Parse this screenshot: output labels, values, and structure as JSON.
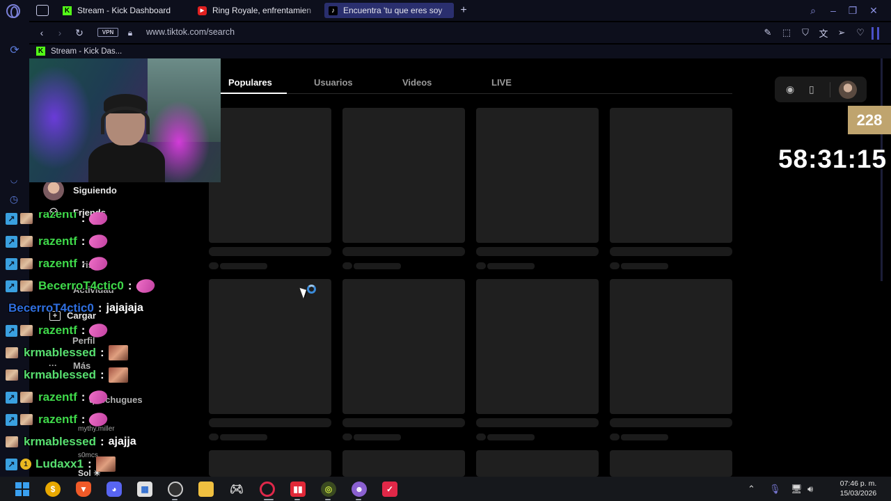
{
  "browser": {
    "tabs": [
      {
        "label": "Stream - Kick Dashboard",
        "favicon": "kick-icon",
        "active": false
      },
      {
        "label": "Ring Royale, enfrentamien",
        "favicon": "youtube-icon",
        "active": false
      },
      {
        "label": "Encuentra 'tu que eres soy",
        "favicon": "tiktok-icon",
        "active": true
      }
    ],
    "new_tab_symbol": "+",
    "vpn_label": "VPN",
    "url": "www.tiktok.com/search",
    "bookmark": {
      "label": "Stream - Kick Das...",
      "favicon": "kick-icon"
    }
  },
  "tiktok": {
    "tabs": [
      "Populares",
      "Usuarios",
      "Videos",
      "LIVE"
    ],
    "active_tab": "Populares",
    "sidebar": {
      "following": "Siguiendo",
      "friends": "Friends",
      "activity": "Actividad",
      "upload": "Cargar",
      "profile": "Perfil",
      "more": "Más",
      "faint_rows": [
        "risas",
        "quechugues"
      ],
      "accounts": [
        "mythy.miller",
        "s0mcs",
        "Sol ☀"
      ]
    }
  },
  "overlay": {
    "viewer_count": "228",
    "timer": "58:31:15"
  },
  "chat": [
    {
      "user": "razentf",
      "color": "#3fd94a",
      "badges": [
        "prime",
        "avatar"
      ],
      "emote": "pink"
    },
    {
      "user": "razentf",
      "color": "#3fd94a",
      "badges": [
        "prime",
        "avatar"
      ],
      "emote": "pink"
    },
    {
      "user": "razentf",
      "color": "#3fd94a",
      "badges": [
        "prime",
        "avatar"
      ],
      "emote": "pink"
    },
    {
      "user": "BecerroT4ctic0",
      "color": "#2f6fe0",
      "badges": [],
      "message": "jajajaja"
    },
    {
      "user": "razentf",
      "color": "#3fd94a",
      "badges": [
        "prime",
        "avatar"
      ],
      "emote": "pink"
    },
    {
      "user": "krmablessed",
      "color": "#58e070",
      "badges": [
        "avatar"
      ],
      "emote": "face"
    },
    {
      "user": "krmablessed",
      "color": "#58e070",
      "badges": [
        "avatar"
      ],
      "emote": "face"
    },
    {
      "user": "razentf",
      "color": "#3fd94a",
      "badges": [
        "prime",
        "avatar"
      ],
      "emote": "pink"
    },
    {
      "user": "razentf",
      "color": "#3fd94a",
      "badges": [
        "prime",
        "avatar"
      ],
      "emote": "pink"
    },
    {
      "user": "krmablessed",
      "color": "#58e070",
      "badges": [
        "avatar"
      ],
      "message": "ajajja"
    },
    {
      "user": "Ludaxx1",
      "color": "#58e070",
      "badges": [
        "prime",
        "gold",
        "avatar"
      ],
      "emote": "face"
    }
  ],
  "chat_separator": ":",
  "taskbar": {
    "apps": [
      "windows-start-icon",
      "coin-app-icon",
      "brave-icon",
      "discord-icon",
      "store-icon",
      "obs-icon",
      "file-explorer-icon",
      "xbox-icon",
      "opera-gx-icon",
      "streaming-app-icon",
      "game-icon",
      "chat-app-icon",
      "kick-studio-icon"
    ],
    "time": "07:46 p. m.",
    "date": "15/03/2026"
  },
  "colors": {
    "chrome_bg": "#0d0f1c",
    "accent": "#2a2f6e",
    "kick_green": "#53fc18",
    "badge_gold": "#bfa46e"
  }
}
